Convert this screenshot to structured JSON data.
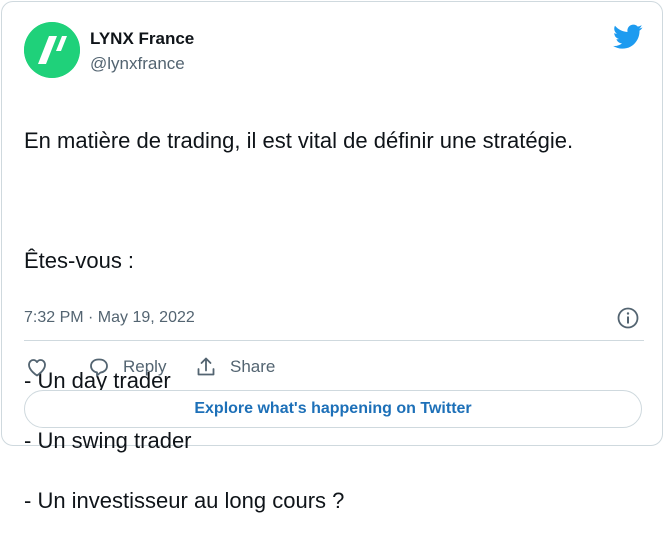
{
  "author": {
    "display_name": "LYNX France",
    "handle": "@lynxfrance",
    "avatar_icon": "lynx-slash-logo-icon",
    "avatar_color": "#1fd17a"
  },
  "brand_icon": "twitter-bird-icon",
  "brand_color": "#1d9bf0",
  "tweet": {
    "line1": "En matière de trading, il est vital de définir une stratégie.",
    "line2": "Êtes-vous :",
    "line3": "- Un day trader",
    "line4": "- Un swing trader",
    "line5": "- Un investisseur au long cours ?"
  },
  "timestamp": "7:32 PM · May 19, 2022",
  "info_icon": "info-icon",
  "actions": {
    "like_icon": "heart-icon",
    "reply_label": "Reply",
    "reply_icon": "speech-bubble-icon",
    "share_label": "Share",
    "share_icon": "share-upload-icon"
  },
  "explore_label": "Explore what's happening on Twitter",
  "colors": {
    "text_primary": "#0f1419",
    "text_secondary": "#536471",
    "link": "#1d70b8",
    "border": "#cfd9de"
  }
}
